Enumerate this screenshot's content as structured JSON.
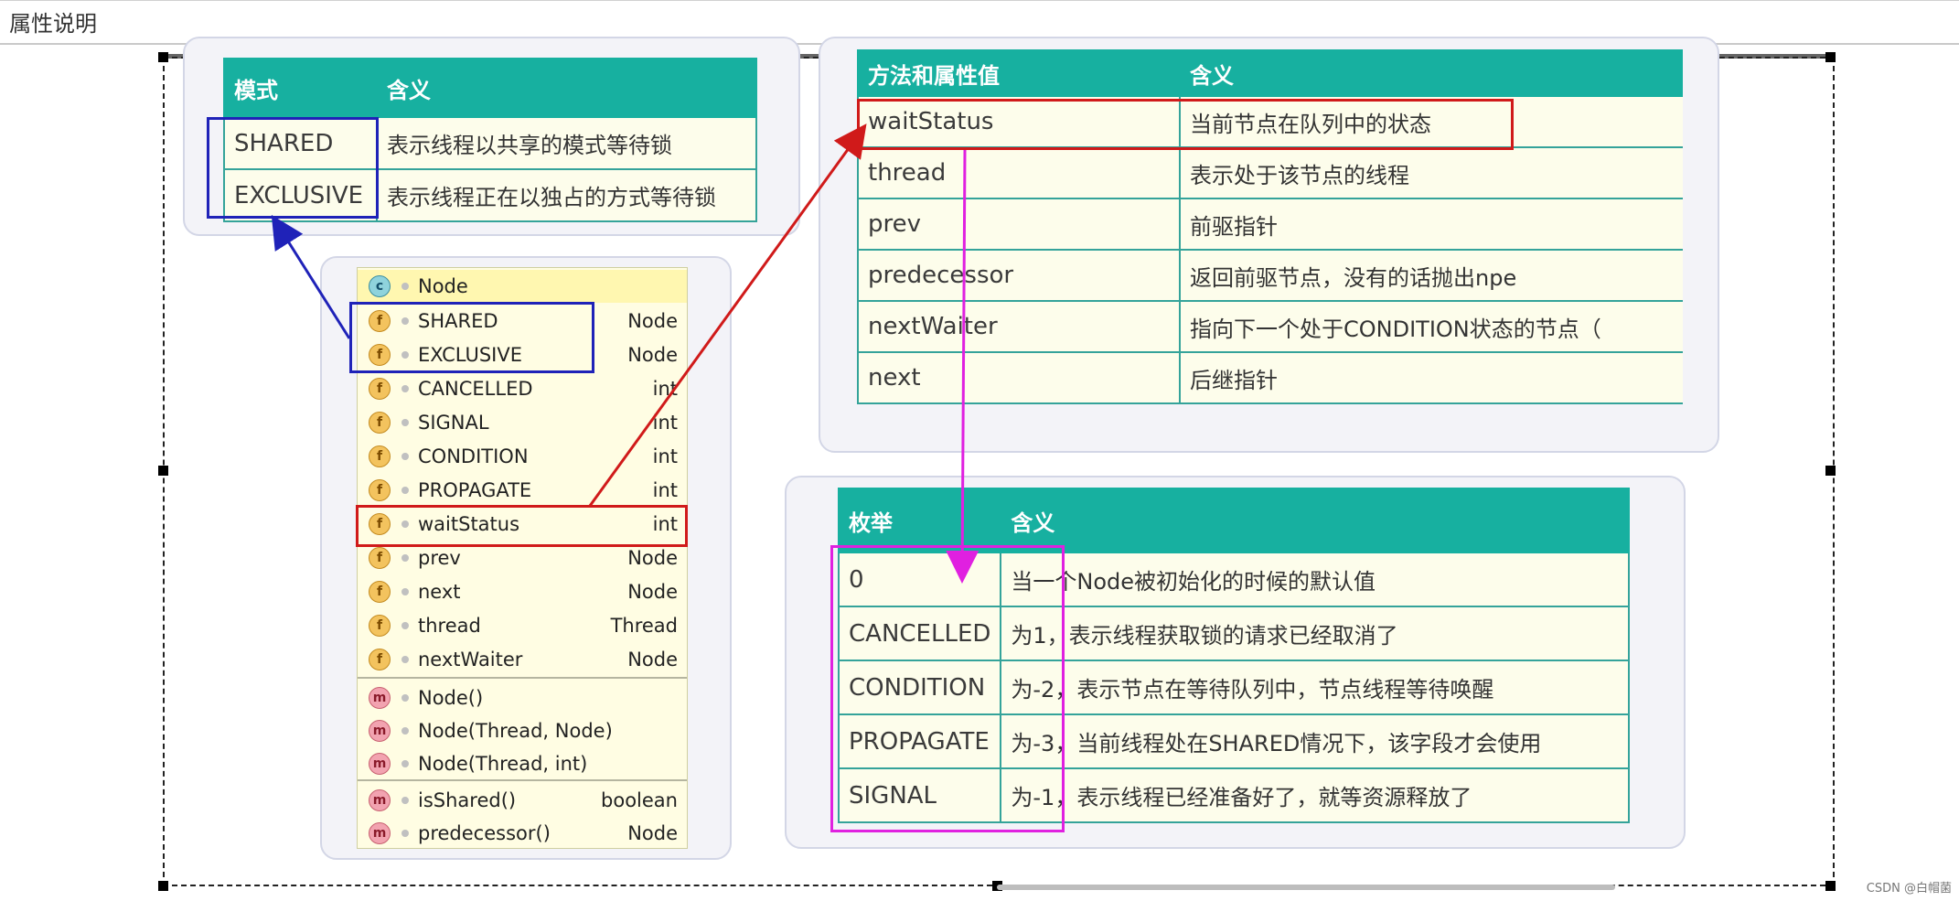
{
  "header": {
    "title": "属性说明"
  },
  "mode_table": {
    "headers": [
      "模式",
      "含义"
    ],
    "rows": [
      [
        "SHARED",
        "表示线程以共享的模式等待锁"
      ],
      [
        "EXCLUSIVE",
        "表示线程正在以独占的方式等待锁"
      ]
    ]
  },
  "method_table": {
    "headers": [
      "方法和属性值",
      "含义"
    ],
    "rows": [
      [
        "waitStatus",
        "当前节点在队列中的状态"
      ],
      [
        "thread",
        "表示处于该节点的线程"
      ],
      [
        "prev",
        "前驱指针"
      ],
      [
        "predecessor",
        "返回前驱节点，没有的话抛出npe"
      ],
      [
        "nextWaiter",
        "指向下一个处于CONDITION状态的节点（"
      ],
      [
        "next",
        "后继指针"
      ]
    ]
  },
  "enum_table": {
    "headers": [
      "枚举",
      "含义"
    ],
    "rows": [
      [
        "0",
        "当一个Node被初始化的时候的默认值"
      ],
      [
        "CANCELLED",
        "为1，表示线程获取锁的请求已经取消了"
      ],
      [
        "CONDITION",
        "为-2，表示节点在等待队列中，节点线程等待唤醒"
      ],
      [
        "PROPAGATE",
        "为-3，当前线程处在SHARED情况下，该字段才会使用"
      ],
      [
        "SIGNAL",
        "为-1，表示线程已经准备好了，就等资源释放了"
      ]
    ]
  },
  "class_diagram": {
    "class_name": "Node",
    "fields": [
      {
        "name": "SHARED",
        "type": "Node",
        "icon": "final-field-icon"
      },
      {
        "name": "EXCLUSIVE",
        "type": "Node",
        "icon": "final-field-icon"
      },
      {
        "name": "CANCELLED",
        "type": "int",
        "icon": "final-field-icon"
      },
      {
        "name": "SIGNAL",
        "type": "int",
        "icon": "final-field-icon"
      },
      {
        "name": "CONDITION",
        "type": "int",
        "icon": "final-field-icon"
      },
      {
        "name": "PROPAGATE",
        "type": "int",
        "icon": "final-field-icon"
      },
      {
        "name": "waitStatus",
        "type": "int",
        "icon": "field-icon"
      },
      {
        "name": "prev",
        "type": "Node",
        "icon": "field-icon"
      },
      {
        "name": "next",
        "type": "Node",
        "icon": "field-icon"
      },
      {
        "name": "thread",
        "type": "Thread",
        "icon": "field-icon"
      },
      {
        "name": "nextWaiter",
        "type": "Node",
        "icon": "field-icon"
      }
    ],
    "constructors": [
      {
        "name": "Node()",
        "type": ""
      },
      {
        "name": "Node(Thread, Node)",
        "type": ""
      },
      {
        "name": "Node(Thread, int)",
        "type": ""
      }
    ],
    "methods": [
      {
        "name": "isShared()",
        "type": "boolean"
      },
      {
        "name": "predecessor()",
        "type": "Node"
      }
    ]
  },
  "colors": {
    "table_header": "#17b0a0",
    "cell_bg": "#fdfdeb",
    "blue_highlight": "#1f22b8",
    "red_highlight": "#d01a1a",
    "magenta_highlight": "#e020e0"
  },
  "watermark": "CSDN @白帽菌"
}
